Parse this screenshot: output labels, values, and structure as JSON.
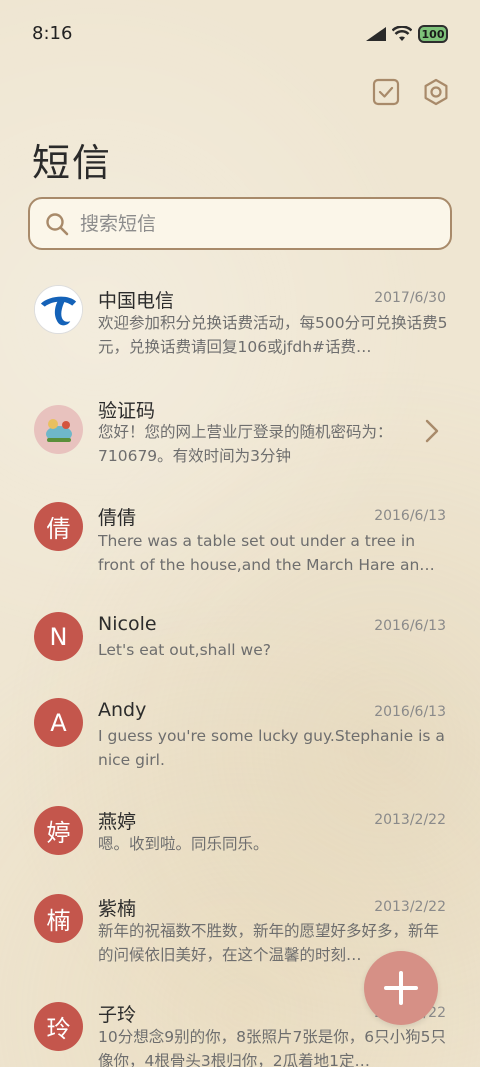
{
  "status": {
    "time": "8:16",
    "battery": "100"
  },
  "header": {
    "title": "短信"
  },
  "search": {
    "placeholder": "搜索短信"
  },
  "messages": [
    {
      "name": "中国电信",
      "date": "2017/6/30",
      "preview": "欢迎参加积分兑换话费活动，每500分可兑换话费5元，兑换话费请回复106或jfdh#话费…",
      "avatar": ""
    },
    {
      "name": "验证码",
      "date": "",
      "preview": "您好！您的网上营业厅登录的随机密码为：710679。有效时间为3分钟",
      "avatar": ""
    },
    {
      "name": "倩倩",
      "date": "2016/6/13",
      "preview": "There was a table set out under a tree in front of the house,and the March Hare an…",
      "avatar": "倩"
    },
    {
      "name": "Nicole",
      "date": "2016/6/13",
      "preview": "Let's eat out,shall we?",
      "avatar": "N"
    },
    {
      "name": "Andy",
      "date": "2016/6/13",
      "preview": "I guess you're some lucky guy.Stephanie is a nice girl.",
      "avatar": "A"
    },
    {
      "name": "燕婷",
      "date": "2013/2/22",
      "preview": "嗯。收到啦。同乐同乐。",
      "avatar": "婷"
    },
    {
      "name": "紫楠",
      "date": "2013/2/22",
      "preview": "新年的祝福数不胜数，新年的愿望好多好多，新年的问候依旧美好，在这个温馨的时刻…",
      "avatar": "楠"
    },
    {
      "name": "子玲",
      "date": "2013/2/22",
      "preview": "10分想念9别的你，8张照片7张是你，6只小狗5只像你，4根骨头3根归你，2瓜着地1定…",
      "avatar": "玲"
    }
  ],
  "colors": {
    "accent": "#c4564c",
    "fab": "#d69086",
    "background": "#efe6d2"
  }
}
